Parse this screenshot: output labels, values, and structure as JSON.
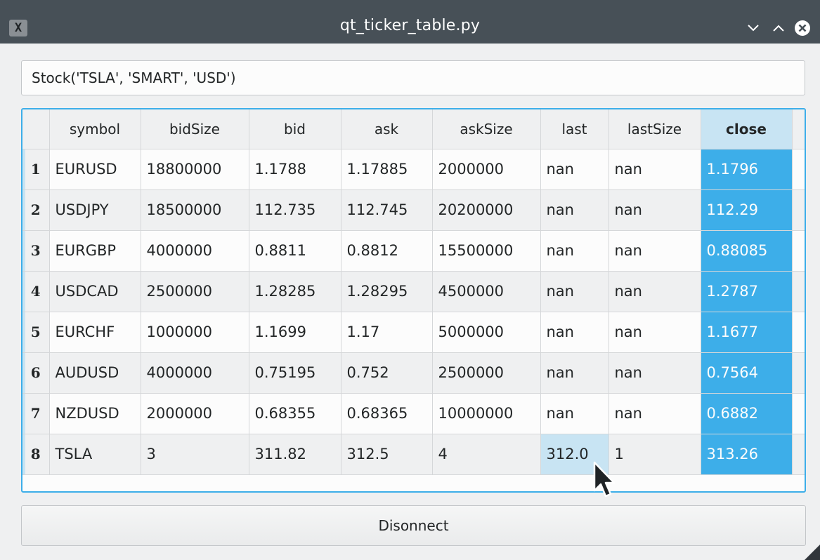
{
  "window": {
    "title": "qt_ticker_table.py",
    "icon": "x-window-icon"
  },
  "search": {
    "value": "Stock('TSLA', 'SMART', 'USD')"
  },
  "table": {
    "columns": [
      "symbol",
      "bidSize",
      "bid",
      "ask",
      "askSize",
      "last",
      "lastSize",
      "close"
    ],
    "selected_column": "close",
    "rows": [
      {
        "num": "1",
        "symbol": "EURUSD",
        "bidSize": "18800000",
        "bid": "1.1788",
        "ask": "1.17885",
        "askSize": "2000000",
        "last": "nan",
        "lastSize": "nan",
        "close": "1.1796"
      },
      {
        "num": "2",
        "symbol": "USDJPY",
        "bidSize": "18500000",
        "bid": "112.735",
        "ask": "112.745",
        "askSize": "20200000",
        "last": "nan",
        "lastSize": "nan",
        "close": "112.29"
      },
      {
        "num": "3",
        "symbol": "EURGBP",
        "bidSize": "4000000",
        "bid": "0.8811",
        "ask": "0.8812",
        "askSize": "15500000",
        "last": "nan",
        "lastSize": "nan",
        "close": "0.88085"
      },
      {
        "num": "4",
        "symbol": "USDCAD",
        "bidSize": "2500000",
        "bid": "1.28285",
        "ask": "1.28295",
        "askSize": "4500000",
        "last": "nan",
        "lastSize": "nan",
        "close": "1.2787"
      },
      {
        "num": "5",
        "symbol": "EURCHF",
        "bidSize": "1000000",
        "bid": "1.1699",
        "ask": "1.17",
        "askSize": "5000000",
        "last": "nan",
        "lastSize": "nan",
        "close": "1.1677"
      },
      {
        "num": "6",
        "symbol": "AUDUSD",
        "bidSize": "4000000",
        "bid": "0.75195",
        "ask": "0.752",
        "askSize": "2500000",
        "last": "nan",
        "lastSize": "nan",
        "close": "0.7564"
      },
      {
        "num": "7",
        "symbol": "NZDUSD",
        "bidSize": "2000000",
        "bid": "0.68355",
        "ask": "0.68365",
        "askSize": "10000000",
        "last": "nan",
        "lastSize": "nan",
        "close": "0.6882"
      },
      {
        "num": "8",
        "symbol": "TSLA",
        "bidSize": "3",
        "bid": "311.82",
        "ask": "312.5",
        "askSize": "4",
        "last": "312.0",
        "lastSize": "1",
        "close": "313.26"
      }
    ]
  },
  "disconnect_button": {
    "label": "Disonnect"
  },
  "colors": {
    "titlebar": "#475057",
    "accent": "#3daee9",
    "selection_light": "#c8e4f3",
    "window_bg": "#eff0f1"
  }
}
